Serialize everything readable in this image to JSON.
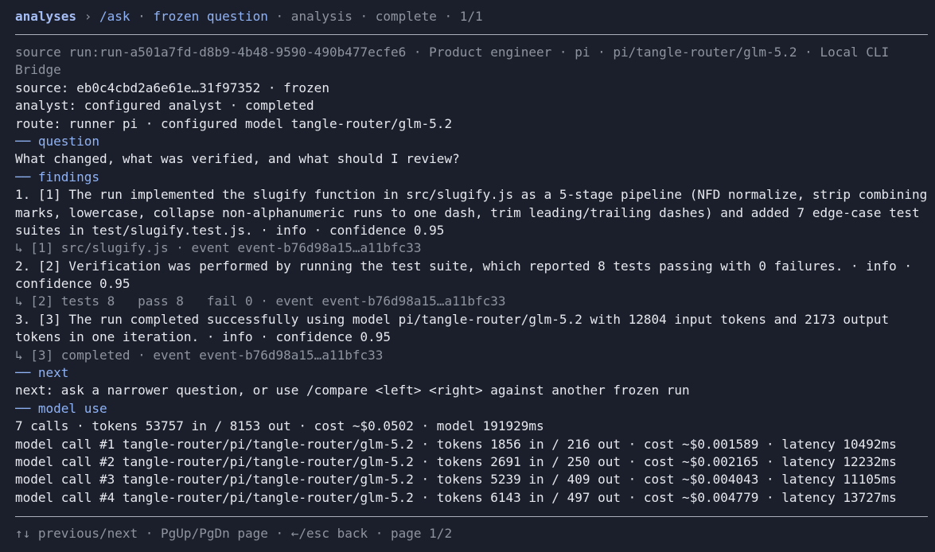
{
  "header": {
    "app": "analyses",
    "sep": " › ",
    "route": "/ask",
    "dot1": " · ",
    "view": "frozen question",
    "rest": " · analysis · complete · 1/1"
  },
  "source": {
    "run_line_1": "source run:run-a501a7fd-d8b9-4b48-9590-490b477ecfe6 · Product engineer · pi · pi/tangle-router/glm-5.2 · Local CLI",
    "run_line_2": "Bridge",
    "source_line": "source: eb0c4cbd2a6e61e…31f97352 · frozen",
    "analyst_line": "analyst: configured analyst · completed",
    "route_line": "route: runner pi · configured model tangle-router/glm-5.2"
  },
  "question": {
    "heading": "── question",
    "text": "What changed, what was verified, and what should I review?"
  },
  "findings": {
    "heading": "── findings",
    "items": [
      {
        "lines": [
          "1. [1] The run implemented the slugify function in src/slugify.js as a 5-stage pipeline (NFD normalize, strip combining",
          "marks, lowercase, collapse non-alphanumeric runs to one dash, trim leading/trailing dashes) and added 7 edge-case test",
          "suites in test/slugify.test.js. · info · confidence 0.95"
        ],
        "evidence": "↳ [1] src/slugify.js · event event-b76d98a15…a11bfc33"
      },
      {
        "lines": [
          "2. [2] Verification was performed by running the test suite, which reported 8 tests passing with 0 failures. · info ·",
          "confidence 0.95"
        ],
        "evidence": "↳ [2] tests 8   pass 8   fail 0 · event event-b76d98a15…a11bfc33"
      },
      {
        "lines": [
          "3. [3] The run completed successfully using model pi/tangle-router/glm-5.2 with 12804 input tokens and 2173 output",
          "tokens in one iteration. · info · confidence 0.95"
        ],
        "evidence": "↳ [3] completed · event event-b76d98a15…a11bfc33"
      }
    ]
  },
  "next": {
    "heading": "── next",
    "text": "next: ask a narrower question, or use /compare <left> <right> against another frozen run"
  },
  "model_use": {
    "heading": "── model use",
    "summary": "7 calls · tokens 53757 in / 8153 out · cost ~$0.0502 · model 191929ms",
    "calls": [
      "model call #1 tangle-router/pi/tangle-router/glm-5.2 · tokens 1856 in / 216 out · cost ~$0.001589 · latency 10492ms",
      "model call #2 tangle-router/pi/tangle-router/glm-5.2 · tokens 2691 in / 250 out · cost ~$0.002165 · latency 12232ms",
      "model call #3 tangle-router/pi/tangle-router/glm-5.2 · tokens 5239 in / 409 out · cost ~$0.004043 · latency 11105ms",
      "model call #4 tangle-router/pi/tangle-router/glm-5.2 · tokens 6143 in / 497 out · cost ~$0.004779 · latency 13727ms"
    ]
  },
  "footer": {
    "hints": "↑↓ previous/next · PgUp/PgDn page · ←/esc back · page 1/2"
  },
  "colors": {
    "background": "#1b1f2b",
    "text": "#e6e8ee",
    "accent": "#8fb2f5",
    "muted": "#8d939f"
  }
}
